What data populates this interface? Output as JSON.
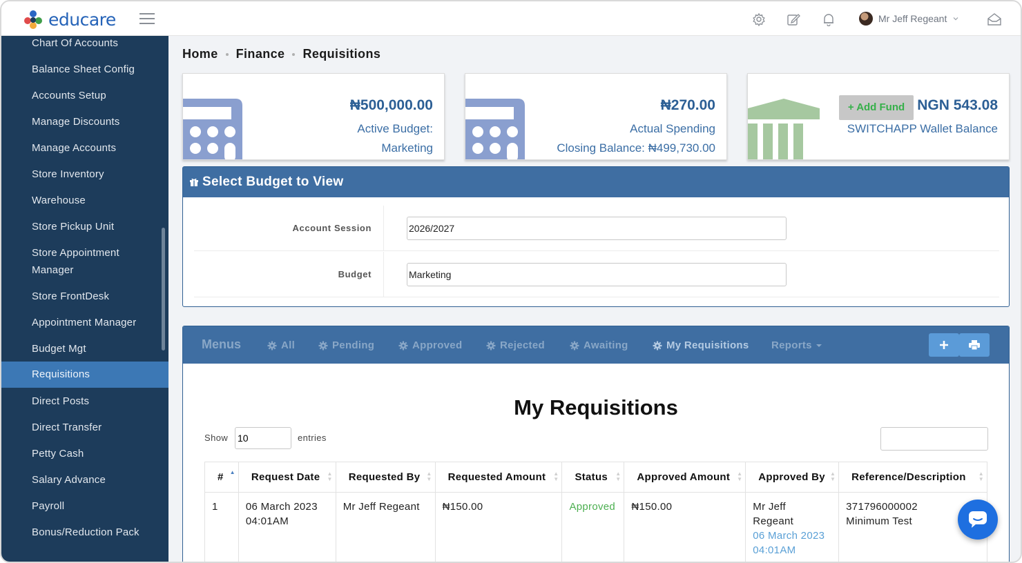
{
  "app": {
    "name": "educare"
  },
  "topbar": {
    "user_name": "Mr Jeff Regeant"
  },
  "sidebar": {
    "items": [
      {
        "label": "Chart Of Accounts"
      },
      {
        "label": "Balance Sheet Config"
      },
      {
        "label": "Accounts Setup"
      },
      {
        "label": "Manage Discounts"
      },
      {
        "label": "Manage Accounts"
      },
      {
        "label": "Store Inventory"
      },
      {
        "label": "Warehouse"
      },
      {
        "label": "Store Pickup Unit"
      },
      {
        "label": "Store Appointment Manager"
      },
      {
        "label": "Store FrontDesk"
      },
      {
        "label": "Appointment Manager"
      },
      {
        "label": "Budget Mgt"
      },
      {
        "label": "Requisitions"
      },
      {
        "label": "Direct Posts"
      },
      {
        "label": "Direct Transfer"
      },
      {
        "label": "Petty Cash"
      },
      {
        "label": "Salary Advance"
      },
      {
        "label": "Payroll"
      },
      {
        "label": "Bonus/Reduction Pack"
      }
    ],
    "active": "Requisitions"
  },
  "breadcrumb": [
    "Home",
    "Finance",
    "Requisitions"
  ],
  "stats": {
    "active_budget": {
      "amount": "₦500,000.00",
      "label_1": "Active Budget:",
      "label_2": "Marketing"
    },
    "actual_spending": {
      "amount": "₦270.00",
      "label_1": "Actual Spending",
      "label_2": "Closing Balance: ₦499,730.00"
    },
    "wallet": {
      "add_fund": "Add Fund",
      "amount": "NGN 543.08",
      "label": "SWITCHAPP Wallet Balance"
    }
  },
  "select_budget": {
    "title": "Select Budget to View",
    "account_session_label": "Account Session",
    "account_session_value": "2026/2027",
    "budget_label": "Budget",
    "budget_value": "Marketing"
  },
  "menus": {
    "title": "Menus",
    "items": [
      "All",
      "Pending",
      "Approved",
      "Rejected",
      "Awaiting",
      "My Requisitions"
    ],
    "reports": "Reports"
  },
  "requisitions": {
    "title": "My Requisitions",
    "show_label": "Show",
    "page_size": "10",
    "entries_label": "entries",
    "columns": [
      "#",
      "Request Date",
      "Requested By",
      "Requested Amount",
      "Status",
      "Approved Amount",
      "Approved By",
      "Reference/Description"
    ],
    "rows": [
      {
        "num": "1",
        "date_1": "06 March 2023",
        "date_2": "04:01AM",
        "requested_by": "Mr Jeff Regeant",
        "requested_amount": "₦150.00",
        "status": "Approved",
        "approved_amount": "₦150.00",
        "approved_by_1": "Mr Jeff",
        "approved_by_2": "Regeant",
        "approved_date_1": "06 March 2023",
        "approved_date_2": "04:01AM",
        "reference": "371796000002",
        "description": "Minimum Test"
      }
    ]
  },
  "colors": {
    "sidebar": "#1d3c5b",
    "active": "#3c78b5",
    "panel_header": "#3f6ea2",
    "approved": "#4caf50"
  }
}
